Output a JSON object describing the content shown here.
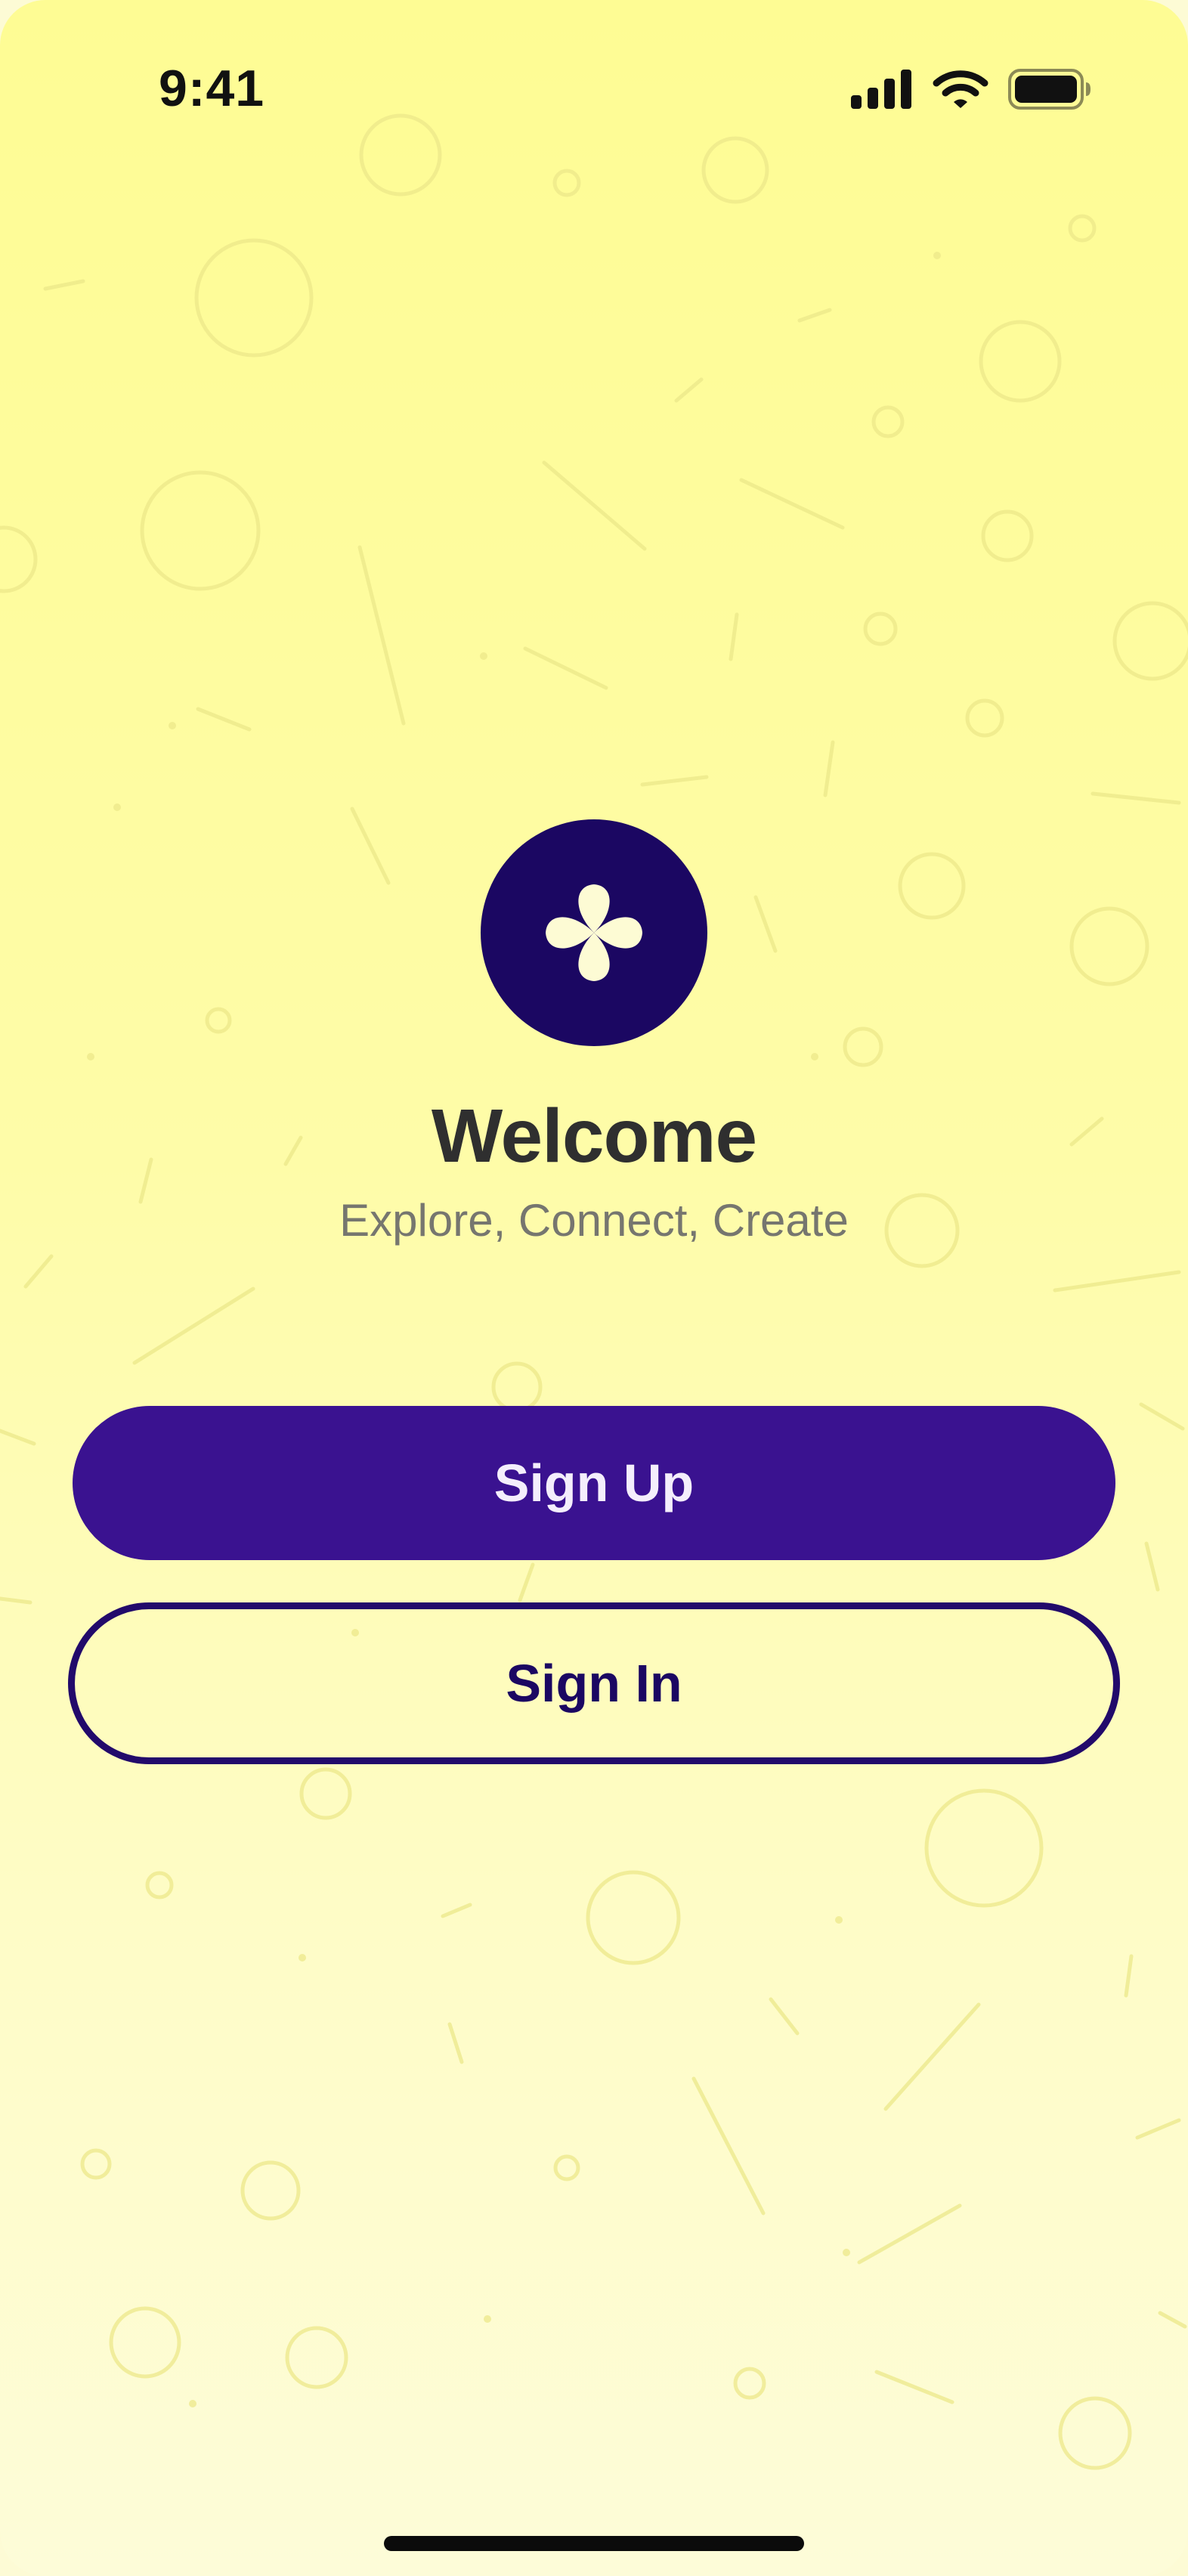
{
  "status_bar": {
    "time": "9:41",
    "icons": [
      "cellular-signal-icon",
      "wifi-icon",
      "battery-icon"
    ]
  },
  "logo": {
    "icon": "clover-icon"
  },
  "welcome": {
    "title": "Welcome",
    "subtitle": "Explore, Connect, Create"
  },
  "actions": {
    "sign_up_label": "Sign Up",
    "sign_in_label": "Sign In"
  },
  "colors": {
    "background_top": "#fefc94",
    "background_bottom": "#fdfcd8",
    "primary": "#3a1290",
    "logo": "#1b0762",
    "title": "#2f2f2f",
    "subtitle": "#76766f"
  }
}
